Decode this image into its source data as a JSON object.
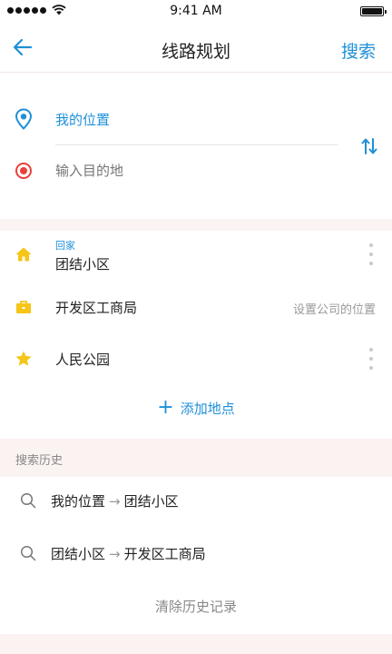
{
  "status_bar": {
    "time": "9:41 AM"
  },
  "nav": {
    "title": "线路规划",
    "search_label": "搜索"
  },
  "route": {
    "from": "我的位置",
    "to_placeholder": "输入目的地"
  },
  "places": [
    {
      "icon": "home-icon",
      "label": "回家",
      "name": "团结小区"
    },
    {
      "icon": "briefcase-icon",
      "name": "开发区工商局",
      "hint": "设置公司的位置"
    },
    {
      "icon": "star-icon",
      "name": "人民公园"
    }
  ],
  "add_place_label": "添加地点",
  "history": {
    "header": "搜索历史",
    "items": [
      {
        "from": "我的位置",
        "to": "团结小区"
      },
      {
        "from": "团结小区",
        "to": "开发区工商局"
      }
    ],
    "clear_label": "清除历史记录"
  },
  "colors": {
    "accent": "#1e90d8",
    "destination_red": "#e8413a",
    "home_yellow": "#f5c518",
    "band_bg": "#fbf2f2"
  }
}
